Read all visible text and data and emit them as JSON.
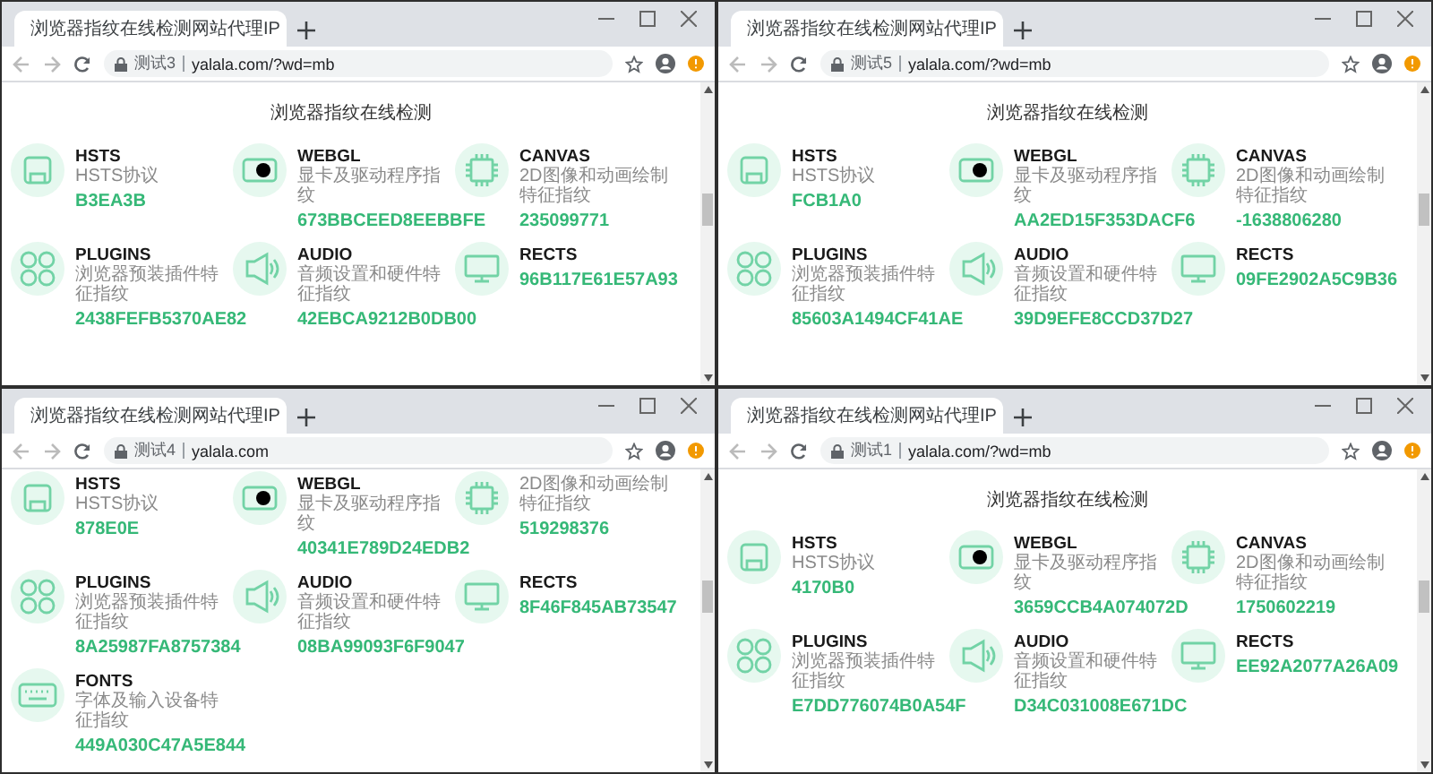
{
  "windows": [
    {
      "tab_title": "浏览器指纹在线检测网站代理IP",
      "site_label": "测试3",
      "url": "yalala.com/?wd=mb",
      "heading": "浏览器指纹在线检测",
      "cards": [
        {
          "kind": "port",
          "title": "HSTS",
          "subtitle": "HSTS协议",
          "value": "B3EA3B"
        },
        {
          "kind": "gpu",
          "title": "WEBGL",
          "subtitle": "显卡及驱动程序指纹",
          "value": "673BBCEED8EEBBFE"
        },
        {
          "kind": "chip",
          "title": "CANVAS",
          "subtitle": "2D图像和动画绘制特征指纹",
          "value": "235099771"
        },
        {
          "kind": "clover",
          "title": "PLUGINS",
          "subtitle": "浏览器预装插件特征指纹",
          "value": "2438FEFB5370AE82"
        },
        {
          "kind": "speaker",
          "title": "AUDIO",
          "subtitle": "音频设置和硬件特征指纹",
          "value": "42EBCA9212B0DB00"
        },
        {
          "kind": "monitor",
          "title": "RECTS",
          "value": "96B117E61E57A93"
        }
      ]
    },
    {
      "tab_title": "浏览器指纹在线检测网站代理IP",
      "site_label": "测试5",
      "url": "yalala.com/?wd=mb",
      "heading": "浏览器指纹在线检测",
      "cards": [
        {
          "kind": "port",
          "title": "HSTS",
          "subtitle": "HSTS协议",
          "value": "FCB1A0"
        },
        {
          "kind": "gpu",
          "title": "WEBGL",
          "subtitle": "显卡及驱动程序指纹",
          "value": "AA2ED15F353DACF6"
        },
        {
          "kind": "chip",
          "title": "CANVAS",
          "subtitle": "2D图像和动画绘制特征指纹",
          "value": "-1638806280"
        },
        {
          "kind": "clover",
          "title": "PLUGINS",
          "subtitle": "浏览器预装插件特征指纹",
          "value": "85603A1494CF41AE"
        },
        {
          "kind": "speaker",
          "title": "AUDIO",
          "subtitle": "音频设置和硬件特征指纹",
          "value": "39D9EFE8CCD37D27"
        },
        {
          "kind": "monitor",
          "title": "RECTS",
          "value": "09FE2902A5C9B36"
        }
      ]
    },
    {
      "tab_title": "浏览器指纹在线检测网站代理IP",
      "site_label": "测试4",
      "url": "yalala.com",
      "cards": [
        {
          "kind": "port",
          "title": "HSTS",
          "subtitle": "HSTS协议",
          "value": "878E0E"
        },
        {
          "kind": "gpu",
          "title": "WEBGL",
          "subtitle": "显卡及驱动程序指纹",
          "value": "40341E789D24EDB2"
        },
        {
          "kind": "chip",
          "subtitle": "2D图像和动画绘制特征指纹",
          "value": "519298376"
        },
        {
          "kind": "clover",
          "title": "PLUGINS",
          "subtitle": "浏览器预装插件特征指纹",
          "value": "8A25987FA8757384"
        },
        {
          "kind": "speaker",
          "title": "AUDIO",
          "subtitle": "音频设置和硬件特征指纹",
          "value": "08BA99093F6F9047"
        },
        {
          "kind": "monitor",
          "title": "RECTS",
          "value": "8F46F845AB73547"
        },
        {
          "kind": "keyboard",
          "title": "FONTS",
          "subtitle": "字体及输入设备特征指纹",
          "value": "449A030C47A5E844"
        }
      ]
    },
    {
      "tab_title": "浏览器指纹在线检测网站代理IP",
      "site_label": "测试1",
      "url": "yalala.com/?wd=mb",
      "heading": "浏览器指纹在线检测",
      "cards": [
        {
          "kind": "port",
          "title": "HSTS",
          "subtitle": "HSTS协议",
          "value": "4170B0"
        },
        {
          "kind": "gpu",
          "title": "WEBGL",
          "subtitle": "显卡及驱动程序指纹",
          "value": "3659CCB4A074072D"
        },
        {
          "kind": "chip",
          "title": "CANVAS",
          "subtitle": "2D图像和动画绘制特征指纹",
          "value": "1750602219"
        },
        {
          "kind": "clover",
          "title": "PLUGINS",
          "subtitle": "浏览器预装插件特征指纹",
          "value": "E7DD776074B0A54F"
        },
        {
          "kind": "speaker",
          "title": "AUDIO",
          "subtitle": "音频设置和硬件特征指纹",
          "value": "D34C031008E671DC"
        },
        {
          "kind": "monitor",
          "title": "RECTS",
          "value": "EE92A2077A26A09"
        }
      ]
    }
  ]
}
